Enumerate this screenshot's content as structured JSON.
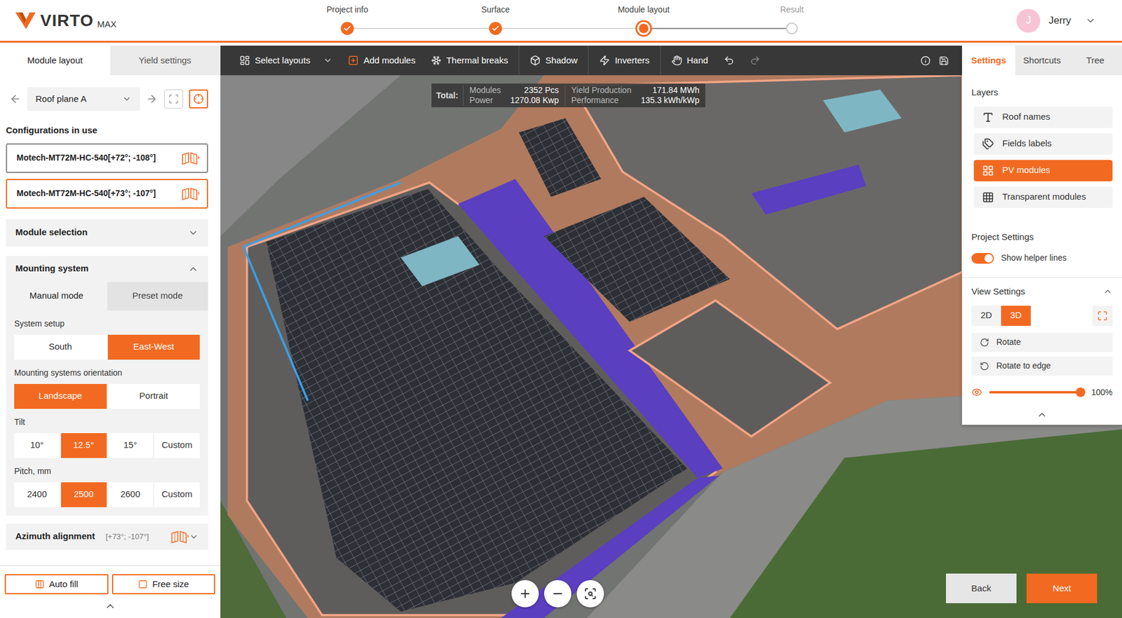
{
  "header": {
    "logo": {
      "name": "VIRTO",
      "suffix": "MAX"
    },
    "steps": [
      {
        "label": "Project info",
        "completed": true,
        "current": false
      },
      {
        "label": "Surface",
        "completed": true,
        "current": false
      },
      {
        "label": "Module layout",
        "completed": false,
        "current": true
      },
      {
        "label": "Result",
        "completed": false,
        "current": false
      }
    ],
    "user": {
      "initial": "J",
      "name": "Jerry"
    }
  },
  "left_panel": {
    "tabs": [
      {
        "label": "Module layout",
        "selected": true
      },
      {
        "label": "Yield settings",
        "selected": false
      }
    ],
    "roof_plane": {
      "value": "Roof plane A"
    },
    "view_tools": [
      {
        "kind": "frame",
        "selected": false
      },
      {
        "kind": "focus",
        "selected": true
      }
    ],
    "configurations": {
      "title": "Configurations in use",
      "items": [
        {
          "label": "Motech-MT72M-HC-540[+72°; -108°]",
          "selected": false
        },
        {
          "label": "Motech-MT72M-HC-540[+73°; -107°]",
          "selected": true
        }
      ]
    },
    "module_selection": {
      "label": "Module selection",
      "expanded": false
    },
    "mounting_system": {
      "label": "Mounting system",
      "expanded": true,
      "modes": [
        {
          "label": "Manual mode",
          "selected": true
        },
        {
          "label": "Preset mode",
          "selected": false
        }
      ],
      "groups": [
        {
          "label": "System setup",
          "options": [
            {
              "label": "South",
              "selected": false
            },
            {
              "label": "East-West",
              "selected": true
            }
          ]
        },
        {
          "label": "Mounting systems orientation",
          "options": [
            {
              "label": "Landscape",
              "selected": true
            },
            {
              "label": "Portrait",
              "selected": false
            }
          ]
        },
        {
          "label": "Tilt",
          "options": [
            {
              "label": "10°",
              "selected": false
            },
            {
              "label": "12.5°",
              "selected": true
            },
            {
              "label": "15°",
              "selected": false
            },
            {
              "label": "Custom",
              "selected": false
            }
          ]
        },
        {
          "label": "Pitch, mm",
          "options": [
            {
              "label": "2400",
              "selected": false
            },
            {
              "label": "2500",
              "selected": true
            },
            {
              "label": "2600",
              "selected": false
            },
            {
              "label": "Custom",
              "selected": false
            }
          ]
        }
      ]
    },
    "azimuth": {
      "label": "Azimuth alignment",
      "value": "[+73°; -107°]",
      "expanded": false
    },
    "actions": [
      {
        "label": "Auto fill",
        "kind": "auto"
      },
      {
        "label": "Free size",
        "kind": "free"
      }
    ]
  },
  "toolbar": {
    "groups": [
      [
        {
          "kind": "layouts",
          "label": "Select layouts",
          "dropdown": true,
          "disabled": false
        },
        {
          "kind": "add",
          "label": "Add modules",
          "dropdown": false,
          "disabled": false
        },
        {
          "kind": "thermal",
          "label": "Thermal breaks",
          "dropdown": false,
          "disabled": false
        }
      ],
      [
        {
          "kind": "shadow",
          "label": "Shadow",
          "dropdown": false,
          "disabled": false
        }
      ],
      [
        {
          "kind": "inverters",
          "label": "Inverters",
          "dropdown": false,
          "disabled": false
        }
      ],
      [
        {
          "kind": "hand",
          "label": "Hand",
          "dropdown": false,
          "disabled": false
        },
        {
          "kind": "undo",
          "label": "",
          "dropdown": false,
          "disabled": false
        },
        {
          "kind": "redo",
          "label": "",
          "dropdown": false,
          "disabled": true
        }
      ]
    ],
    "utilities": [
      {
        "kind": "info"
      },
      {
        "kind": "save"
      }
    ]
  },
  "totals": {
    "label": "Total:",
    "columns": [
      [
        {
          "label": "Modules",
          "value": "2352 Pcs"
        },
        {
          "label": "Power",
          "value": "1270.08 Kwp"
        }
      ],
      [
        {
          "label": "Yield Production",
          "value": "171.84 MWh"
        },
        {
          "label": "Performance",
          "value": "135.3 kWh/kWp"
        }
      ]
    ]
  },
  "right_panel": {
    "tabs": [
      {
        "label": "Settings",
        "selected": true
      },
      {
        "label": "Shortcuts",
        "selected": false
      },
      {
        "label": "Tree",
        "selected": false
      }
    ],
    "layers": {
      "title": "Layers",
      "items": [
        {
          "label": "Roof names",
          "kind": "roof_names",
          "selected": false
        },
        {
          "label": "Fields labels",
          "kind": "field_labels",
          "selected": false
        },
        {
          "label": "PV modules",
          "kind": "pv_modules",
          "selected": true
        },
        {
          "label": "Transparent modules",
          "kind": "transparent_modules",
          "selected": false
        }
      ]
    },
    "project_settings": {
      "title": "Project Settings",
      "toggles": [
        {
          "label": "Show helper lines",
          "on": true
        }
      ]
    },
    "view_settings": {
      "title": "View Settings",
      "expanded": true,
      "modes": [
        {
          "label": "2D",
          "selected": false
        },
        {
          "label": "3D",
          "selected": true
        }
      ],
      "actions": [
        {
          "label": "Rotate",
          "kind": "rotate"
        },
        {
          "label": "Rotate to edge",
          "kind": "rotate_edge"
        }
      ],
      "opacity": {
        "level": 1,
        "reading": "100%"
      }
    },
    "collapsed": false
  },
  "map_controls": [
    {
      "kind": "zoom_in"
    },
    {
      "kind": "zoom_out"
    },
    {
      "kind": "fit"
    }
  ],
  "navigation": [
    {
      "label": "Back",
      "primary": false
    },
    {
      "label": "Next",
      "primary": true
    }
  ]
}
